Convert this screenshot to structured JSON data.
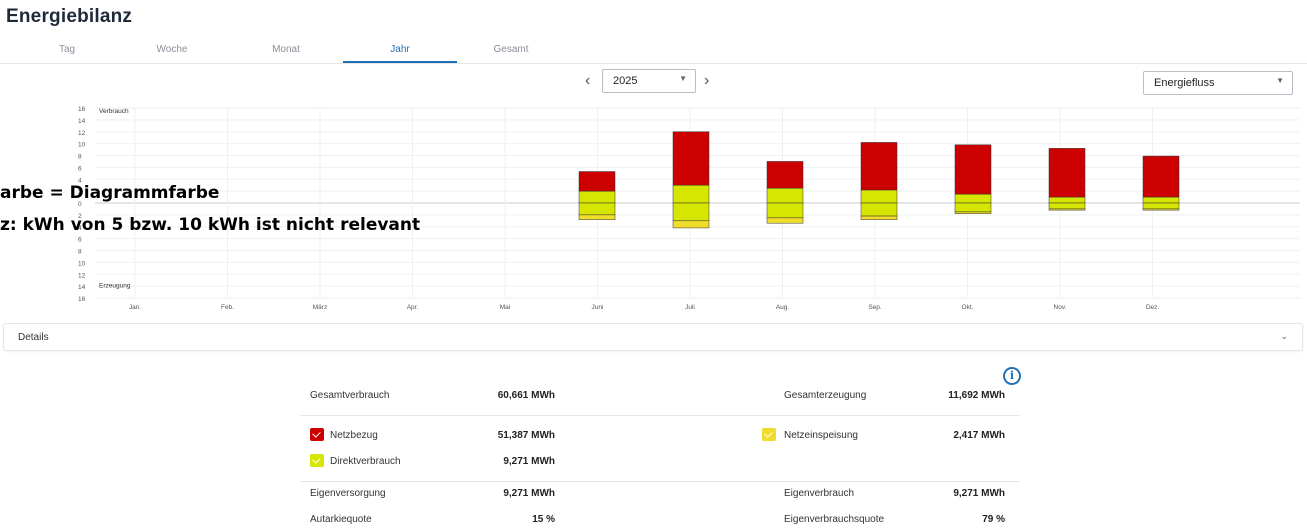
{
  "title": "Energiebilanz",
  "tabs": [
    "Tag",
    "Woche",
    "Monat",
    "Jahr",
    "Gesamt"
  ],
  "active_tab": "Jahr",
  "year_select": {
    "value": "2025"
  },
  "view_select": {
    "value": "Energiefluss"
  },
  "annotation": {
    "line1": "arbe = Diagrammfarbe",
    "line2": "z: kWh von 5 bzw. 10 kWh ist nicht relevant"
  },
  "details": {
    "label": "Details"
  },
  "colors": {
    "netzbezug": "#cc0000",
    "direkt": "#d6e600",
    "einspeisung": "#f0dc2a",
    "accent": "#1f6fb5"
  },
  "chart_data": {
    "type": "bar",
    "top_label": "Verbrauch",
    "bottom_label": "Erzeugung",
    "y_ticks": [
      "16",
      "14",
      "12",
      "10",
      "8",
      "6",
      "4",
      "2",
      "0",
      "2",
      "4",
      "6",
      "8",
      "10",
      "12",
      "14",
      "16"
    ],
    "ylim": [
      -16,
      16
    ],
    "categories": [
      "Jan.",
      "Feb.",
      "März",
      "Apr.",
      "Mai",
      "Juni",
      "Juli",
      "Aug.",
      "Sep.",
      "Okt.",
      "Nov.",
      "Dez."
    ],
    "series": [
      {
        "name": "Netzbezug",
        "values": [
          0,
          0,
          0,
          0,
          0,
          3.3,
          9.0,
          4.5,
          8.0,
          8.3,
          8.2,
          6.9
        ]
      },
      {
        "name": "Direktverbrauch",
        "values": [
          0,
          0,
          0,
          0,
          0,
          2.0,
          3.0,
          2.5,
          2.2,
          1.5,
          1.0,
          1.0
        ]
      },
      {
        "name": "Direktverbrauch (Erzeugung)",
        "values": [
          0,
          0,
          0,
          0,
          0,
          -2.0,
          -3.0,
          -2.5,
          -2.2,
          -1.5,
          -1.0,
          -1.0
        ]
      },
      {
        "name": "Netzeinspeisung",
        "values": [
          0,
          0,
          0,
          0,
          0,
          -0.8,
          -1.2,
          -0.9,
          -0.6,
          -0.3,
          -0.2,
          -0.2
        ]
      }
    ]
  },
  "stats": {
    "gesamtverbrauch_label": "Gesamtverbrauch",
    "gesamtverbrauch": "60,661 MWh",
    "gesamterzeugung_label": "Gesamterzeugung",
    "gesamterzeugung": "11,692 MWh",
    "netzbezug_label": "Netzbezug",
    "netzbezug": "51,387 MWh",
    "netzeinspeisung_label": "Netzeinspeisung",
    "netzeinspeisung": "2,417 MWh",
    "direktverbrauch_label": "Direktverbrauch",
    "direktverbrauch": "9,271 MWh",
    "eigenversorgung_label": "Eigenversorgung",
    "eigenversorgung": "9,271 MWh",
    "eigenverbrauch_label": "Eigenverbrauch",
    "eigenverbrauch": "9,271 MWh",
    "autarkiequote_label": "Autarkiequote",
    "autarkiequote": "15 %",
    "eigenverbrauchsquote_label": "Eigenverbrauchsquote",
    "eigenverbrauchsquote": "79 %"
  }
}
